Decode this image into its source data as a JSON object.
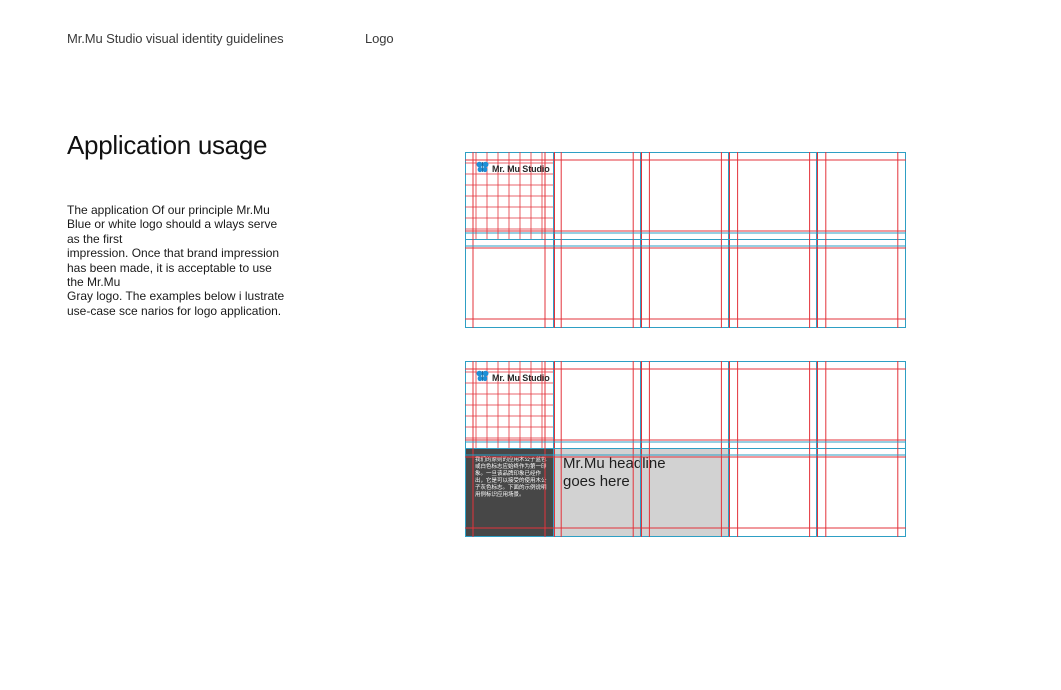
{
  "header": {
    "doc_title": "Mr.Mu Studio visual identity guidelines",
    "section": "Logo"
  },
  "main": {
    "title": "Application usage",
    "body": "The application Of our principle Mr.Mu\nBlue or white logo should a wlays serve\nas the first\nimpression. Once that brand impression\nhas been made, it is acceptable to use\nthe Mr.Mu\nGray logo. The examples below i lustrate\nuse-case sce narios for logo application."
  },
  "examples": {
    "logo_text": "Mr. Mu Studio",
    "logo_icon": "butterfly-icon",
    "headline": "Mr.Mu headline\ngoes here",
    "sample_text": "我们的原则的应用木公子蓝色或白色标志应始终作为第一印象。一旦该品牌印象已经作出，它是可以接受的使用木公子灰色标志。下面的示例说明用例标识应用场景。"
  },
  "colors": {
    "grid_red": "#e3333b",
    "grid_blue": "#2e9fc4",
    "logo_blue": "#1e8fd6",
    "dark_block": "#474747",
    "gray_block": "#d2d2d2"
  }
}
